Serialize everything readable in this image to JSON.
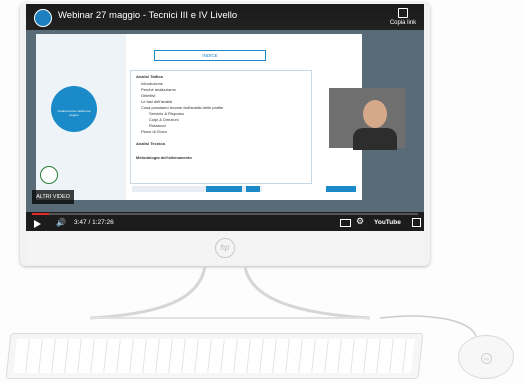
{
  "youtube": {
    "video_title": "Webinar 27 maggio - Tecnici III e IV Livello",
    "copy_link_label": "Copia link",
    "more_videos_label": "ALTRI VIDEO",
    "time_display": "3:47 / 1:27:26",
    "youtube_label": "YouTube",
    "progress_fraction": 0.043
  },
  "slide": {
    "title": "INDICE",
    "badge_text": "Analisi tecnico tattica sul doppio",
    "index_items": [
      {
        "text": "Analisi Tattica",
        "bold": true
      },
      {
        "text": "Introduzione",
        "bold": false
      },
      {
        "text": "Perché analizziamo",
        "bold": false
      },
      {
        "text": "Obiettivi",
        "bold": false
      },
      {
        "text": "Le fasi dell'analisi",
        "bold": false
      },
      {
        "text": "Cosa possiamo trovare dall'analisi delle partite",
        "bold": false
      },
      {
        "text": "Servizio & Risposta",
        "bold": false
      },
      {
        "text": "Colpi & Direzioni",
        "bold": false
      },
      {
        "text": "Rotazioni",
        "bold": false
      },
      {
        "text": "Piano di Gioco",
        "bold": false
      },
      {
        "text": "Analisi Tecnica",
        "bold": true
      },
      {
        "text": "Metodologia dell'allenamento",
        "bold": true
      }
    ]
  },
  "colors": {
    "accent": "#1b8ac9",
    "progress": "#e52d27",
    "bezel": "#f2f2f2"
  },
  "icons": [
    "channel-avatar",
    "copy-link-icon",
    "play-icon",
    "volume-icon",
    "subtitles-icon",
    "gear-icon",
    "fullscreen-icon",
    "hp-logo"
  ]
}
